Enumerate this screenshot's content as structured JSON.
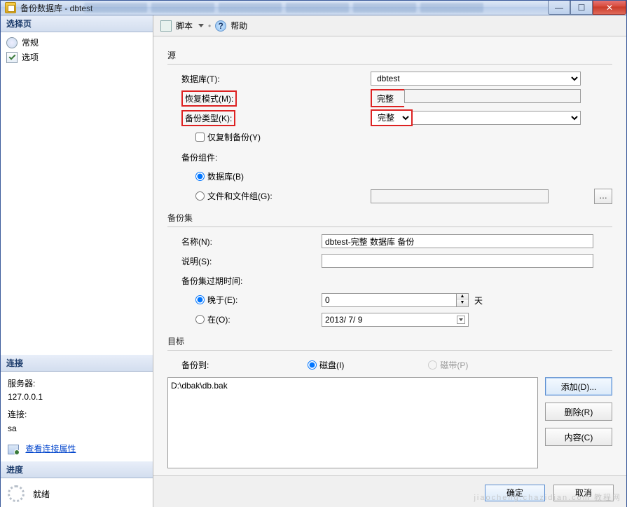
{
  "window": {
    "title": "备份数据库 - dbtest"
  },
  "sidebar": {
    "select_page_hdr": "选择页",
    "items": [
      {
        "label": "常规"
      },
      {
        "label": "选项"
      }
    ],
    "connection_hdr": "连接",
    "server_label": "服务器:",
    "server_value": "127.0.0.1",
    "conn_label": "连接:",
    "conn_value": "sa",
    "view_conn_props": "查看连接属性",
    "progress_hdr": "进度",
    "progress_status": "就绪"
  },
  "toolbar": {
    "script": "脚本",
    "help": "帮助"
  },
  "source": {
    "title": "源",
    "database_label": "数据库(T):",
    "database_value": "dbtest",
    "recovery_label": "恢复模式(M):",
    "recovery_value": "完整",
    "backup_type_label": "备份类型(K):",
    "backup_type_value": "完整",
    "copy_only_label": "仅复制备份(Y)",
    "component_label": "备份组件:",
    "comp_db": "数据库(B)",
    "comp_files": "文件和文件组(G):"
  },
  "set": {
    "title": "备份集",
    "name_label": "名称(N):",
    "name_value": "dbtest-完整 数据库 备份",
    "desc_label": "说明(S):",
    "desc_value": "",
    "expire_label": "备份集过期时间:",
    "after_label": "晚于(E):",
    "after_value": "0",
    "after_unit": "天",
    "on_label": "在(O):",
    "on_value": "2013/ 7/ 9"
  },
  "dest": {
    "title": "目标",
    "backup_to_label": "备份到:",
    "disk": "磁盘(I)",
    "tape": "磁带(P)",
    "path": "D:\\dbak\\db.bak",
    "add": "添加(D)...",
    "remove": "删除(R)",
    "contents": "内容(C)"
  },
  "footer": {
    "ok": "确定",
    "cancel": "取消"
  },
  "watermark": "jiaocheng.chazidian.com 教程网"
}
